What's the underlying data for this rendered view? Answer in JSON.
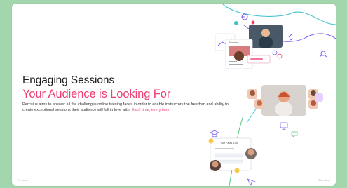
{
  "slide": {
    "heading": "Engaging Sessions",
    "subheading": "Your Audience is Looking For",
    "body_text": "Percuius aims to answer all the challenges online training faces in order to enable instructors the freedom and ability to create exceptional sessions their audience will fall in love with.",
    "body_accent": "Each time, every time!",
    "footer_left": "Percuius",
    "footer_right": "Slide Deck"
  },
  "collage": {
    "poll_card_title": "Sessions",
    "quiz_card_title": "True Facts & Lie",
    "badge_label": "15",
    "reaction_emoji": "😀"
  },
  "colors": {
    "background": "#a4d6ad",
    "slide": "#ffffff",
    "heading": "#1d1d1f",
    "accent_pink": "#ec3f72",
    "line_teal": "#3ec1c9",
    "line_purple": "#7a5cf0",
    "line_green": "#55c47a"
  },
  "icons": [
    "video-tile-icon",
    "person-icon",
    "chat-icon",
    "graduation-cap-icon",
    "monitor-icon",
    "cursor-icon",
    "spark-icon"
  ]
}
